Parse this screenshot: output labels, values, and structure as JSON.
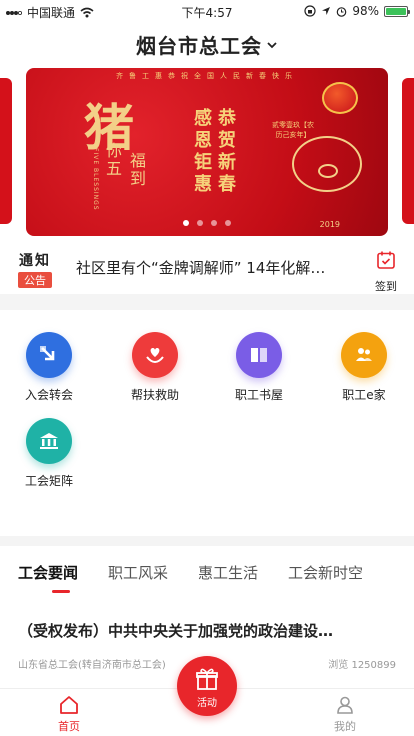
{
  "status": {
    "carrier": "中国联通",
    "time": "下午4:57",
    "battery": "98%",
    "battery_level": 0.98
  },
  "header": {
    "title": "烟台市总工会"
  },
  "banner": {
    "top_line": "齐鲁工惠恭祝全国人民新春快乐",
    "glyph": "猪",
    "line_a": "你五",
    "line_b": "福到",
    "english": "FIVE BLESSINGS",
    "verse_a": "感恩钜惠",
    "verse_b": "恭贺新春",
    "stamp": "贰零壹玖【农历己亥年】",
    "year": "2019",
    "slide_count": 4,
    "active_slide": 0
  },
  "notice": {
    "title": "通知",
    "tag": "公告",
    "text": "社区里有个“金牌调解师” 14年化解…",
    "checkin_label": "签到"
  },
  "services": [
    {
      "label": "入会转会",
      "color": "#2f6fe0",
      "icon": "transfer-icon"
    },
    {
      "label": "帮扶救助",
      "color": "#ee3b3b",
      "icon": "heart-hand-icon"
    },
    {
      "label": "职工书屋",
      "color": "#7a5de6",
      "icon": "book-icon"
    },
    {
      "label": "职工e家",
      "color": "#f4a20f",
      "icon": "family-icon"
    },
    {
      "label": "工会矩阵",
      "color": "#1fb2a6",
      "icon": "institution-icon"
    }
  ],
  "news": {
    "tabs": [
      "工会要闻",
      "职工风采",
      "惠工生活",
      "工会新时空"
    ],
    "active_tab": 0,
    "title": "（受权发布）中共中央关于加强党的政治建设…",
    "source": "山东省总工会(转自济南市总工会)",
    "views": "浏览 1250899"
  },
  "tabbar": {
    "home": "首页",
    "activity": "活动",
    "mine": "我的"
  }
}
